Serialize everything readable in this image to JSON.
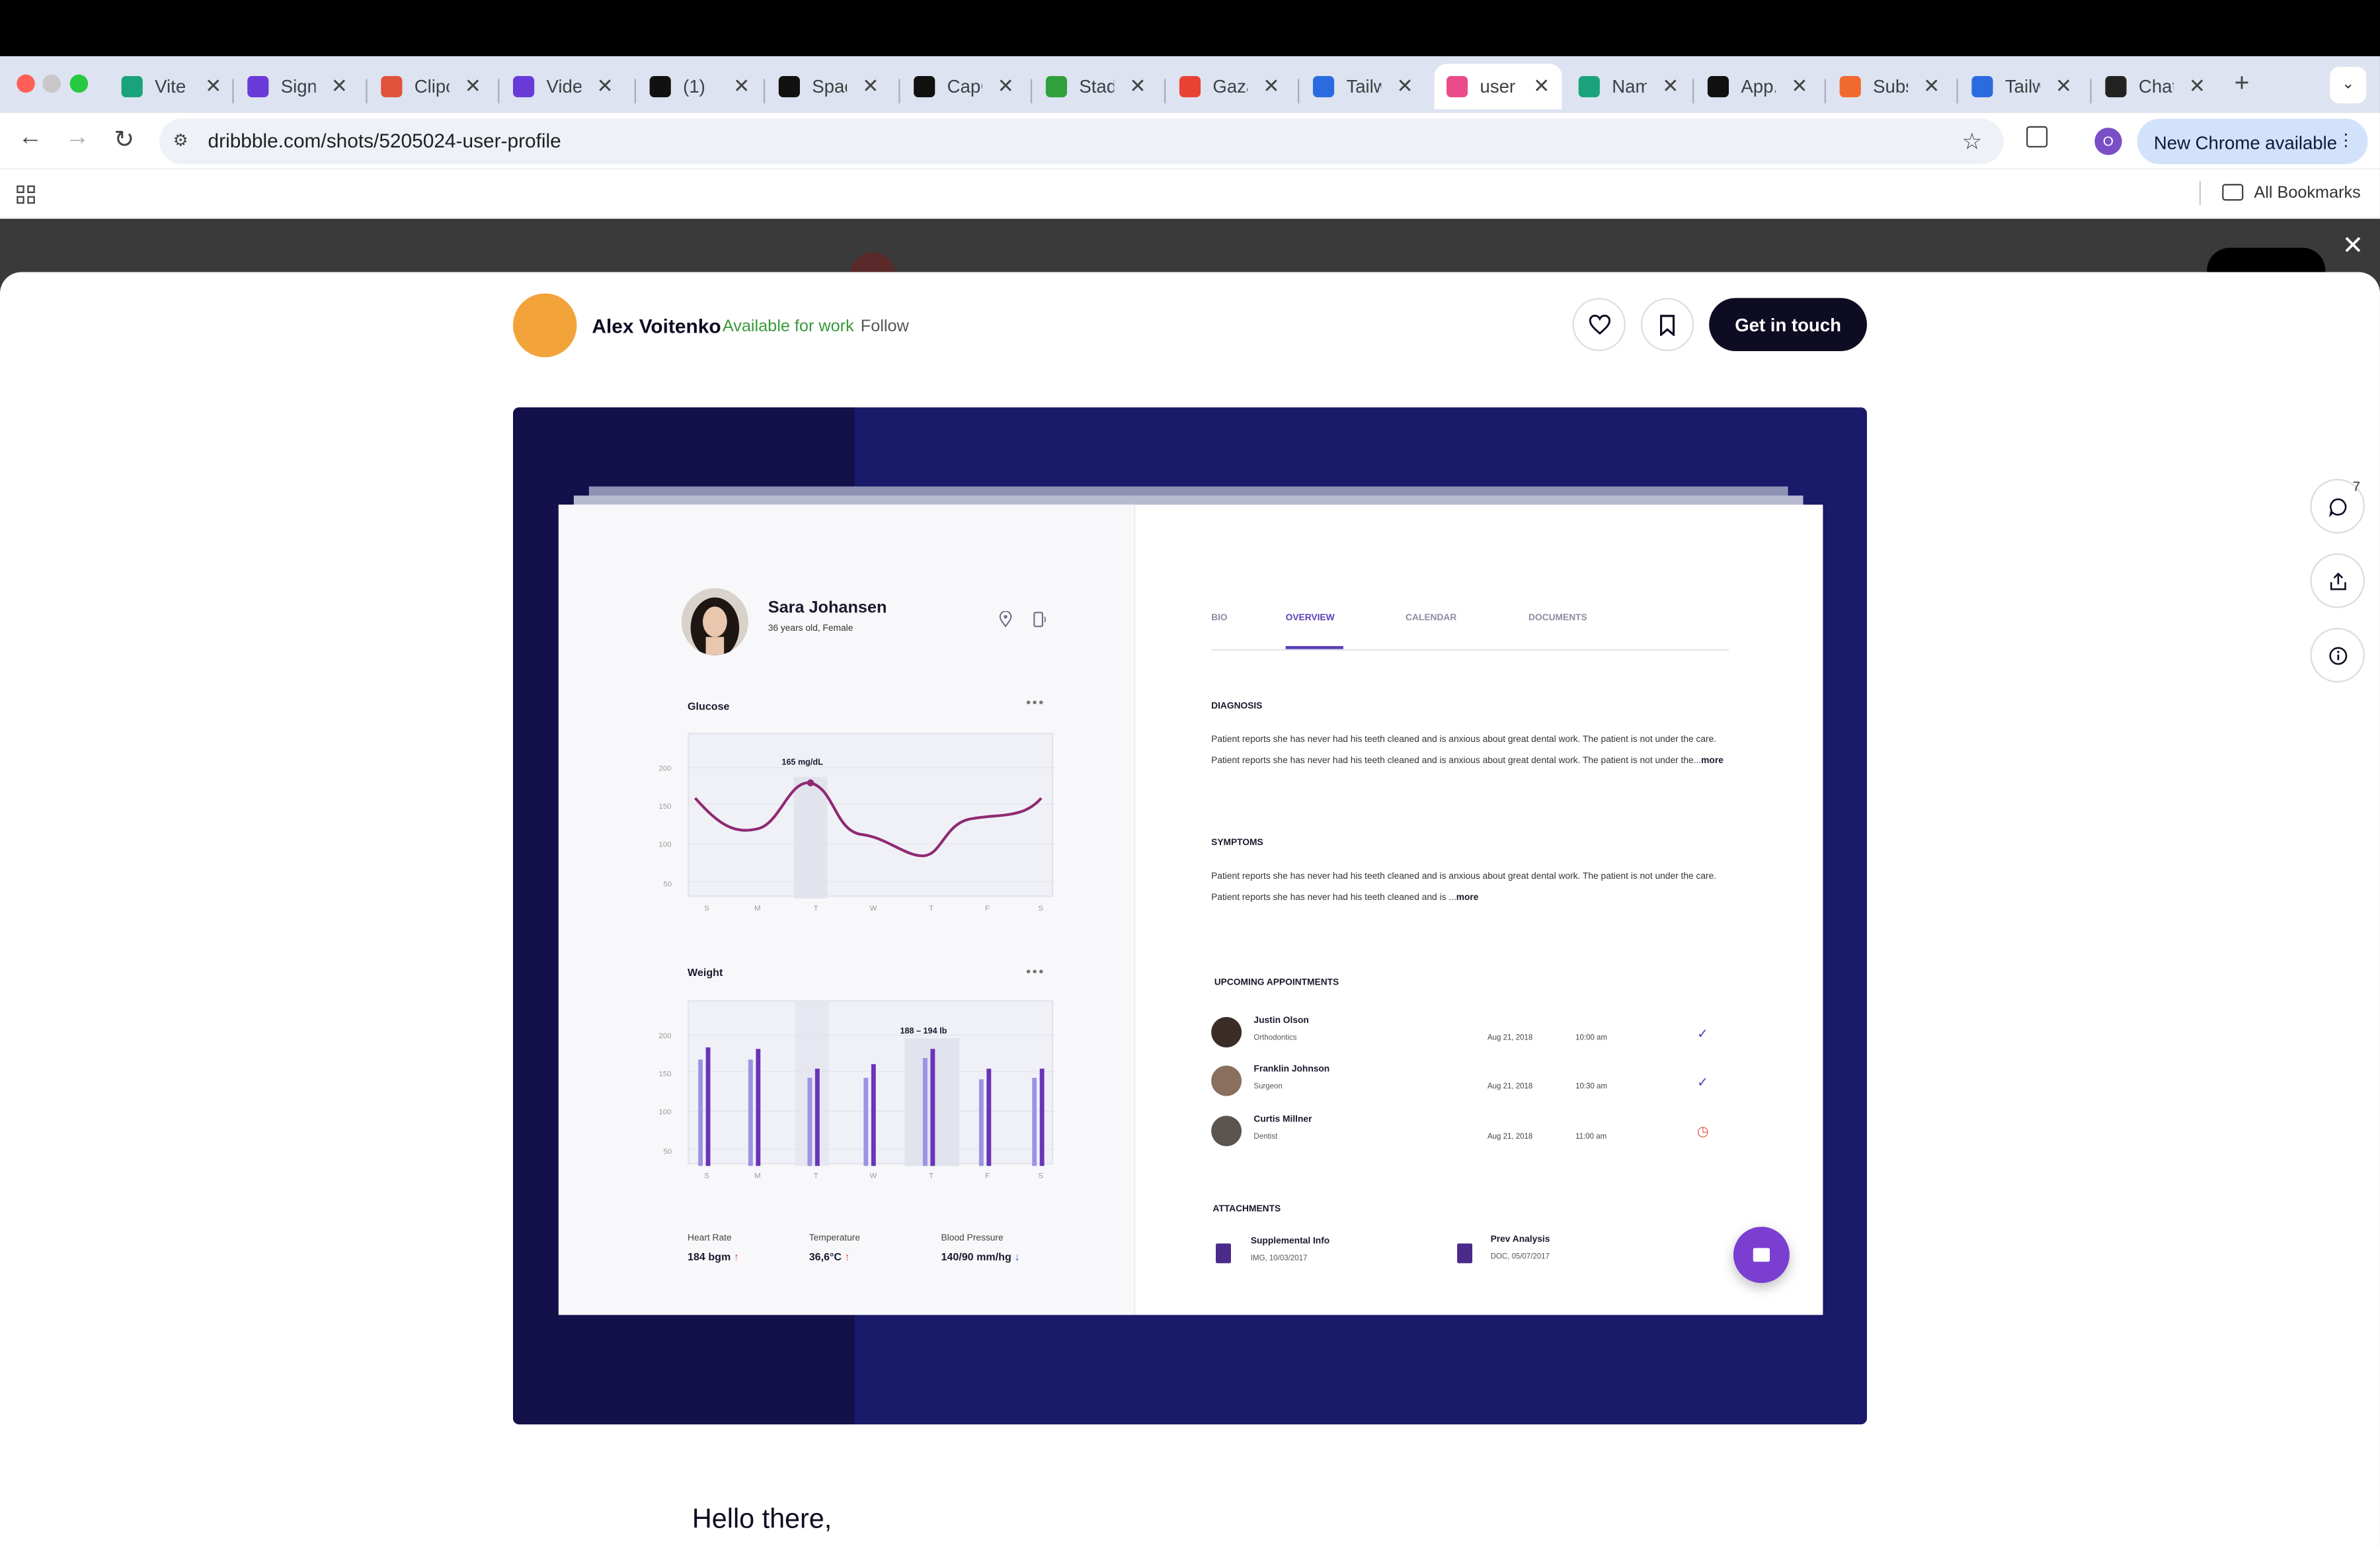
{
  "browser": {
    "tabs": [
      {
        "title": "Vite A",
        "color": "#1aa37a"
      },
      {
        "title": "Sign",
        "color": "#6a3ad8"
      },
      {
        "title": "Clipc",
        "color": "#e0533a"
      },
      {
        "title": "Video",
        "color": "#6a3ad8"
      },
      {
        "title": "(1)",
        "color": "#111111"
      },
      {
        "title": "Space",
        "color": "#111111"
      },
      {
        "title": "CapC",
        "color": "#111111"
      },
      {
        "title": "Stadi",
        "color": "#2fa03a"
      },
      {
        "title": "Gaza",
        "color": "#e94235"
      },
      {
        "title": "Tailw",
        "color": "#2a6be0"
      },
      {
        "title": "user",
        "color": "#ea4c89"
      },
      {
        "title": "Nam",
        "color": "#1aa37a"
      },
      {
        "title": "App.",
        "color": "#111111"
      },
      {
        "title": "Subs",
        "color": "#f06a2e"
      },
      {
        "title": "Tailw",
        "color": "#2a6be0"
      },
      {
        "title": "Chat",
        "color": "#222222"
      }
    ],
    "active_tab_index": 10,
    "url": "dribbble.com/shots/5205024-user-profile",
    "new_chrome_label": "New Chrome available",
    "profile_initial": "O",
    "all_bookmarks": "All Bookmarks"
  },
  "shot": {
    "designer_name": "Alex Voitenko",
    "availability": "Available for work",
    "follow_label": "Follow",
    "get_in_touch": "Get in touch",
    "comment_count": "7",
    "hello": "Hello there,"
  },
  "dashboard": {
    "patient": {
      "name": "Sara Johansen",
      "age_gender": "36 years old,  Female"
    },
    "glucose": {
      "title": "Glucose",
      "tooltip": "165 mg/dL"
    },
    "weight": {
      "title": "Weight",
      "tooltip": "188 – 194 lb"
    },
    "y_ticks": [
      "200",
      "150",
      "100",
      "50"
    ],
    "days": [
      "S",
      "M",
      "T",
      "W",
      "T",
      "F",
      "S"
    ],
    "vitals": [
      {
        "label": "Heart Rate",
        "value": "184 bgm",
        "trend": "up"
      },
      {
        "label": "Temperature",
        "value": "36,6°C",
        "trend": "up"
      },
      {
        "label": "Blood Pressure",
        "value": "140/90 mm/hg",
        "trend": "down"
      }
    ],
    "tabs": [
      "BIO",
      "OVERVIEW",
      "CALENDAR",
      "DOCUMENTS"
    ],
    "diagnosis": {
      "title": "DIAGNOSIS",
      "text": "Patient reports she has never had his teeth cleaned and is anxious about great dental work. The patient is not under the care. Patient reports she has never had his teeth cleaned and is anxious about great dental work. The patient is not under the...",
      "more": "more"
    },
    "symptoms": {
      "title": "SYMPTOMS",
      "text": "Patient reports she has never had his teeth cleaned and is anxious about great dental work. The patient is not under the care. Patient reports she has never had his teeth cleaned and is ...",
      "more": "more"
    },
    "appointments_title": "UPCOMING APPOINTMENTS",
    "appointments": [
      {
        "name": "Justin Olson",
        "role": "Orthodontics",
        "date": "Aug 21, 2018",
        "time": "10:00 am",
        "status": "done"
      },
      {
        "name": "Franklin Johnson",
        "role": "Surgeon",
        "date": "Aug 21, 2018",
        "time": "10:30 am",
        "status": "done"
      },
      {
        "name": "Curtis Millner",
        "role": "Dentist",
        "date": "Aug 21, 2018",
        "time": "11:00 am",
        "status": "pending"
      }
    ],
    "attachments_title": "ATTACHMENTS",
    "attachments": [
      {
        "name": "Supplemental Info",
        "meta": "IMG, 10/03/2017"
      },
      {
        "name": "Prev Analysis",
        "meta": "DOC, 05/07/2017"
      }
    ]
  },
  "colors": {
    "shot_bg": "#1a1a6b",
    "accent_purple": "#5b3fb8",
    "glucose_line": "#8e2a72",
    "bar_light": "#9b93e3",
    "bar_dark": "#6a35b8"
  }
}
